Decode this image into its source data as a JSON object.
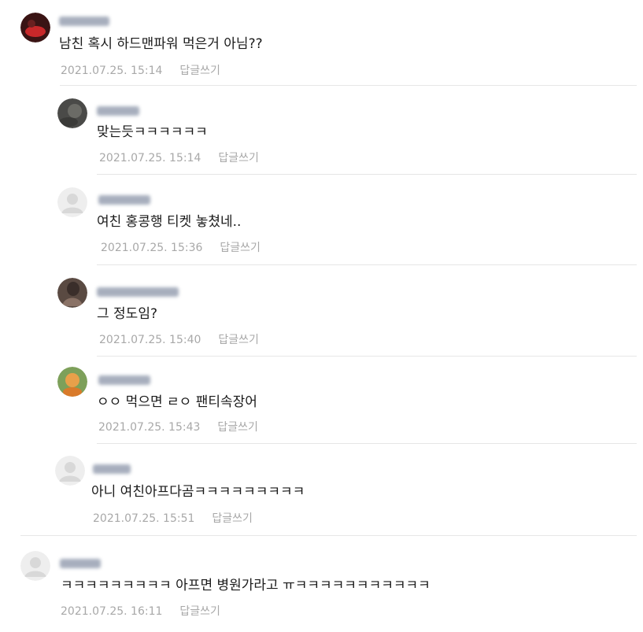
{
  "comments": [
    {
      "avatar_icon": "user-photo-red-icon",
      "author_masked": true,
      "text": "남친 혹시 하드맨파워 먹은거 아님??",
      "timestamp": "2021.07.25. 15:14",
      "reply_label": "답글쓰기",
      "is_reply": false
    },
    {
      "avatar_icon": "user-photo-dark-icon",
      "author_masked": true,
      "text": "맞는듯ㅋㅋㅋㅋㅋㅋ",
      "timestamp": "2021.07.25. 15:14",
      "reply_label": "답글쓰기",
      "is_reply": true
    },
    {
      "avatar_icon": "default-avatar-icon",
      "author_masked": true,
      "text": "여친 홍콩행 티켓 놓쳤네..",
      "timestamp": "2021.07.25. 15:36",
      "reply_label": "답글쓰기",
      "is_reply": true
    },
    {
      "avatar_icon": "user-photo-brown-icon",
      "author_masked": true,
      "text": "그 정도임?",
      "timestamp": "2021.07.25. 15:40",
      "reply_label": "답글쓰기",
      "is_reply": true
    },
    {
      "avatar_icon": "user-photo-orange-icon",
      "author_masked": true,
      "text": "ㅇㅇ 먹으면 ㄹㅇ 팬티속장어",
      "timestamp": "2021.07.25. 15:43",
      "reply_label": "답글쓰기",
      "is_reply": true
    },
    {
      "avatar_icon": "default-avatar-icon",
      "author_masked": true,
      "text": "아니 여친아프다곰ㅋㅋㅋㅋㅋㅋㅋㅋㅋ",
      "timestamp": "2021.07.25. 15:51",
      "reply_label": "답글쓰기",
      "is_reply": true
    },
    {
      "avatar_icon": "default-avatar-icon",
      "author_masked": true,
      "text": "ㅋㅋㅋㅋㅋㅋㅋㅋㅋ 아프면 병원가라고 ㅠㅋㅋㅋㅋㅋㅋㅋㅋㅋㅋㅋ",
      "timestamp": "2021.07.25. 16:11",
      "reply_label": "답글쓰기",
      "is_reply": false
    }
  ],
  "colors": {
    "text": "#1a1a1a",
    "meta": "#a8a8a8",
    "divider": "#e6e6e6",
    "masked_name": "#8a94a8"
  }
}
